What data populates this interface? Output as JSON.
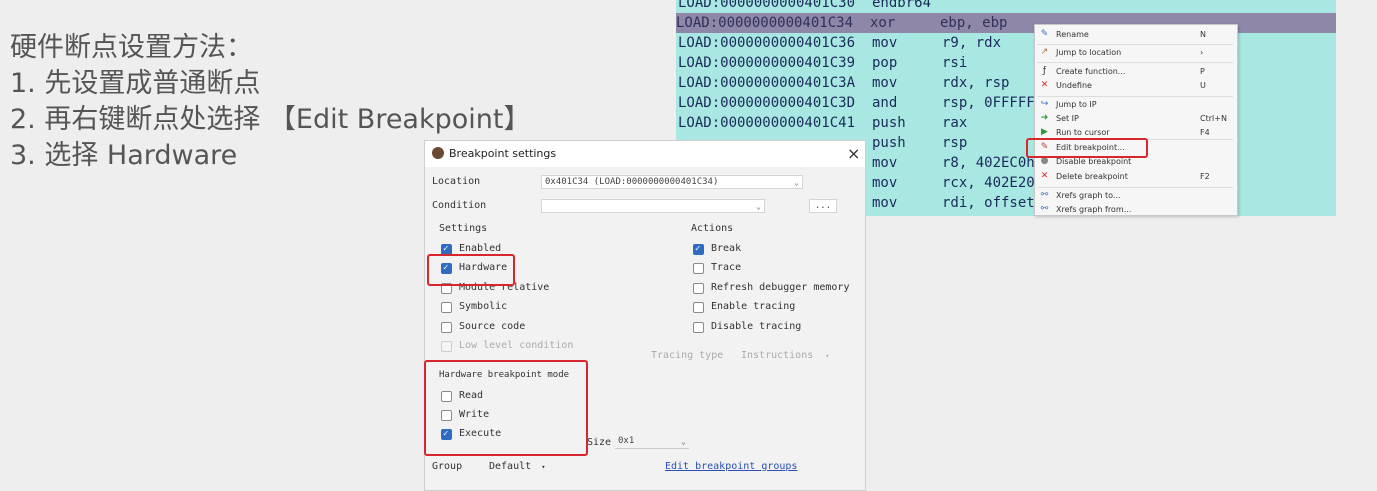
{
  "slide": {
    "title": "硬件断点设置方法：",
    "steps": [
      "1.  先设置成普通断点",
      "2.  再右键断点处选择 【Edit Breakpoint】",
      "3.  选择 Hardware"
    ]
  },
  "disassembly": [
    {
      "addr": "LOAD:0000000000401C30",
      "mnemonic": "endbr64",
      "operands": ""
    },
    {
      "addr": "LOAD:0000000000401C34",
      "mnemonic": "xor",
      "operands": "ebp, ebp"
    },
    {
      "addr": "LOAD:0000000000401C36",
      "mnemonic": "mov",
      "operands": "r9, rdx"
    },
    {
      "addr": "LOAD:0000000000401C39",
      "mnemonic": "pop",
      "operands": "rsi"
    },
    {
      "addr": "LOAD:0000000000401C3A",
      "mnemonic": "mov",
      "operands": "rdx, rsp"
    },
    {
      "addr": "LOAD:0000000000401C3D",
      "mnemonic": "and",
      "operands": "rsp, 0FFFFF"
    },
    {
      "addr": "LOAD:0000000000401C41",
      "mnemonic": "push",
      "operands": "rax"
    },
    {
      "addr": "",
      "mnemonic": "push",
      "operands": "rsp"
    },
    {
      "addr": "",
      "mnemonic": "mov",
      "operands": "r8, 402EC0h"
    },
    {
      "addr": "",
      "mnemonic": "mov",
      "operands": "rcx, 402E20"
    },
    {
      "addr": "",
      "mnemonic": "mov",
      "operands": "rdi, offset"
    }
  ],
  "context_menu": {
    "items": [
      {
        "label": "Rename",
        "shortcut": "N",
        "icon": "rename-icon",
        "glyph": "✎",
        "color": "#3a6fc0"
      },
      {
        "label": "Jump to location",
        "shortcut": "›",
        "icon": "jump-location-icon",
        "glyph": "↗",
        "color": "#b06a2a"
      },
      {
        "label": "Create function...",
        "shortcut": "P",
        "icon": "function-icon",
        "glyph": "ƒ",
        "color": "#333333"
      },
      {
        "label": "Undefine",
        "shortcut": "U",
        "icon": "close-icon",
        "glyph": "✕",
        "color": "#d8272c"
      },
      {
        "label": "Jump to IP",
        "shortcut": "",
        "icon": "jump-ip-icon",
        "glyph": "↪",
        "color": "#3a6fc0"
      },
      {
        "label": "Set IP",
        "shortcut": "Ctrl+N",
        "icon": "set-ip-icon",
        "glyph": "➜",
        "color": "#2d9a3a"
      },
      {
        "label": "Run to cursor",
        "shortcut": "F4",
        "icon": "run-icon",
        "glyph": "▶",
        "color": "#2d9a3a"
      },
      {
        "label": "Edit breakpoint...",
        "shortcut": "",
        "icon": "edit-breakpoint-icon",
        "glyph": "✎",
        "color": "#c0392b"
      },
      {
        "label": "Disable breakpoint",
        "shortcut": "",
        "icon": "disable-breakpoint-icon",
        "glyph": "●",
        "color": "#888888"
      },
      {
        "label": "Delete breakpoint",
        "shortcut": "F2",
        "icon": "delete-breakpoint-icon",
        "glyph": "✕",
        "color": "#d8272c"
      },
      {
        "label": "Xrefs graph to...",
        "shortcut": "",
        "icon": "xrefs-to-icon",
        "glyph": "⚯",
        "color": "#3a6fc0"
      },
      {
        "label": "Xrefs graph from...",
        "shortcut": "",
        "icon": "xrefs-from-icon",
        "glyph": "⚯",
        "color": "#3a6fc0"
      }
    ]
  },
  "dialog": {
    "title": "Breakpoint settings",
    "close": "×",
    "location_label": "Location",
    "location_value": "0x401C34 (LOAD:0000000000401C34)",
    "condition_label": "Condition",
    "condition_value": "",
    "condition_button": "...",
    "settings_label": "Settings",
    "settings": [
      {
        "label": "Enabled",
        "checked": true,
        "disabled": false
      },
      {
        "label": "Hardware",
        "checked": true,
        "disabled": false
      },
      {
        "label": "Module relative",
        "checked": false,
        "disabled": false
      },
      {
        "label": "Symbolic",
        "checked": false,
        "disabled": false
      },
      {
        "label": "Source code",
        "checked": false,
        "disabled": false
      },
      {
        "label": "Low level condition",
        "checked": false,
        "disabled": true
      }
    ],
    "actions_label": "Actions",
    "actions": [
      {
        "label": "Break",
        "checked": true
      },
      {
        "label": "Trace",
        "checked": false
      },
      {
        "label": "Refresh debugger memory",
        "checked": false
      },
      {
        "label": "Enable tracing",
        "checked": false
      },
      {
        "label": "Disable tracing",
        "checked": false
      }
    ],
    "tracing_type_label": "Tracing type",
    "tracing_type_value": "Instructions",
    "hw_mode_label": "Hardware breakpoint mode",
    "hw_modes": [
      {
        "label": "Read",
        "checked": false
      },
      {
        "label": "Write",
        "checked": false
      },
      {
        "label": "Execute",
        "checked": true
      }
    ],
    "size_label": "Size",
    "size_value": "0x1",
    "group_label": "Group",
    "group_value": "Default",
    "edit_groups_link": "Edit breakpoint groups"
  },
  "colors": {
    "highlight": "#d8272c",
    "disasm_bg": "#a9e8e2",
    "selected_line": "#8e87a8",
    "check": "#2f6bc1"
  }
}
